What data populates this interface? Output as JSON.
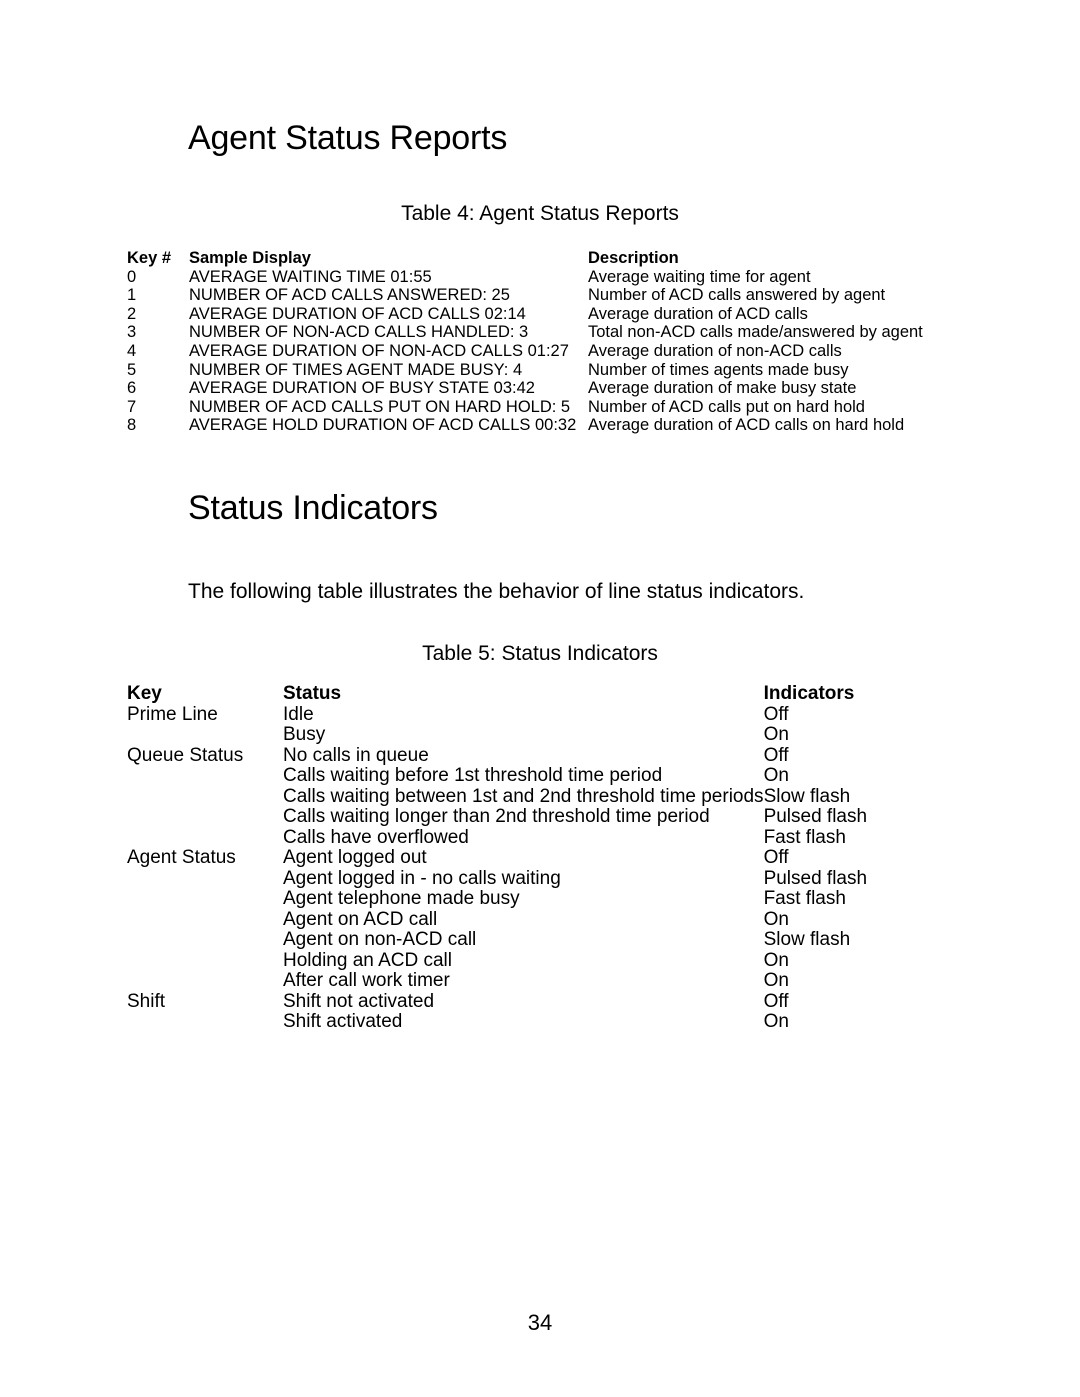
{
  "document": {
    "page_number": "34"
  },
  "sections": {
    "agent_status_reports": {
      "heading": "Agent Status Reports",
      "caption": "Table 4: Agent Status Reports",
      "columns": {
        "key": "Key #",
        "sample": "Sample Display",
        "description": "Description"
      },
      "rows": [
        {
          "key": "0",
          "sample": "AVERAGE WAITING TIME 01:55",
          "description": "Average waiting time for agent"
        },
        {
          "key": "1",
          "sample": "NUMBER OF ACD CALLS ANSWERED: 25",
          "description": "Number of ACD calls answered by agent"
        },
        {
          "key": "2",
          "sample": "AVERAGE DURATION OF ACD CALLS 02:14",
          "description": "Average duration of ACD calls"
        },
        {
          "key": "3",
          "sample": "NUMBER OF NON-ACD CALLS HANDLED: 3",
          "description": "Total non-ACD calls made/answered by agent"
        },
        {
          "key": "4",
          "sample": "AVERAGE DURATION OF NON-ACD CALLS 01:27",
          "description": "Average duration of non-ACD calls"
        },
        {
          "key": "5",
          "sample": "NUMBER OF TIMES AGENT MADE BUSY: 4",
          "description": "Number of times agents made busy"
        },
        {
          "key": "6",
          "sample": "AVERAGE DURATION OF BUSY STATE 03:42",
          "description": "Average duration of make busy state"
        },
        {
          "key": "7",
          "sample": "NUMBER OF ACD CALLS PUT ON HARD HOLD: 5",
          "description": "Number of ACD calls put on hard hold"
        },
        {
          "key": "8",
          "sample": "AVERAGE HOLD DURATION OF ACD CALLS 00:32",
          "description": "Average duration of ACD calls on hard hold"
        }
      ]
    },
    "status_indicators": {
      "heading": "Status Indicators",
      "intro": "The following table illustrates the behavior of line status indicators.",
      "caption": "Table 5: Status Indicators",
      "columns": {
        "key": "Key",
        "status": "Status",
        "indicators": "Indicators"
      },
      "rows": [
        {
          "key": "Prime Line",
          "status": "Idle",
          "indicator": "Off"
        },
        {
          "key": "",
          "status": "Busy",
          "indicator": "On"
        },
        {
          "key": "Queue Status",
          "status": "No calls in queue",
          "indicator": "Off"
        },
        {
          "key": "",
          "status": "Calls waiting before 1st threshold time period",
          "indicator": "On"
        },
        {
          "key": "",
          "status": "Calls waiting between 1st and 2nd threshold time periods",
          "indicator": "Slow flash"
        },
        {
          "key": "",
          "status": "Calls waiting longer than 2nd threshold time period",
          "indicator": "Pulsed flash"
        },
        {
          "key": "",
          "status": "Calls have overflowed",
          "indicator": "Fast flash"
        },
        {
          "key": "Agent Status",
          "status": "Agent logged out",
          "indicator": "Off"
        },
        {
          "key": "",
          "status": "Agent logged in - no calls waiting",
          "indicator": "Pulsed flash"
        },
        {
          "key": "",
          "status": "Agent telephone made busy",
          "indicator": "Fast flash"
        },
        {
          "key": "",
          "status": "Agent on ACD call",
          "indicator": "On"
        },
        {
          "key": "",
          "status": "Agent on non-ACD call",
          "indicator": "Slow flash"
        },
        {
          "key": "",
          "status": "Holding an ACD call",
          "indicator": "On"
        },
        {
          "key": "",
          "status": "After call work timer",
          "indicator": "On"
        },
        {
          "key": "Shift",
          "status": "Shift not activated",
          "indicator": "Off"
        },
        {
          "key": "",
          "status": "Shift activated",
          "indicator": "On"
        }
      ]
    }
  }
}
